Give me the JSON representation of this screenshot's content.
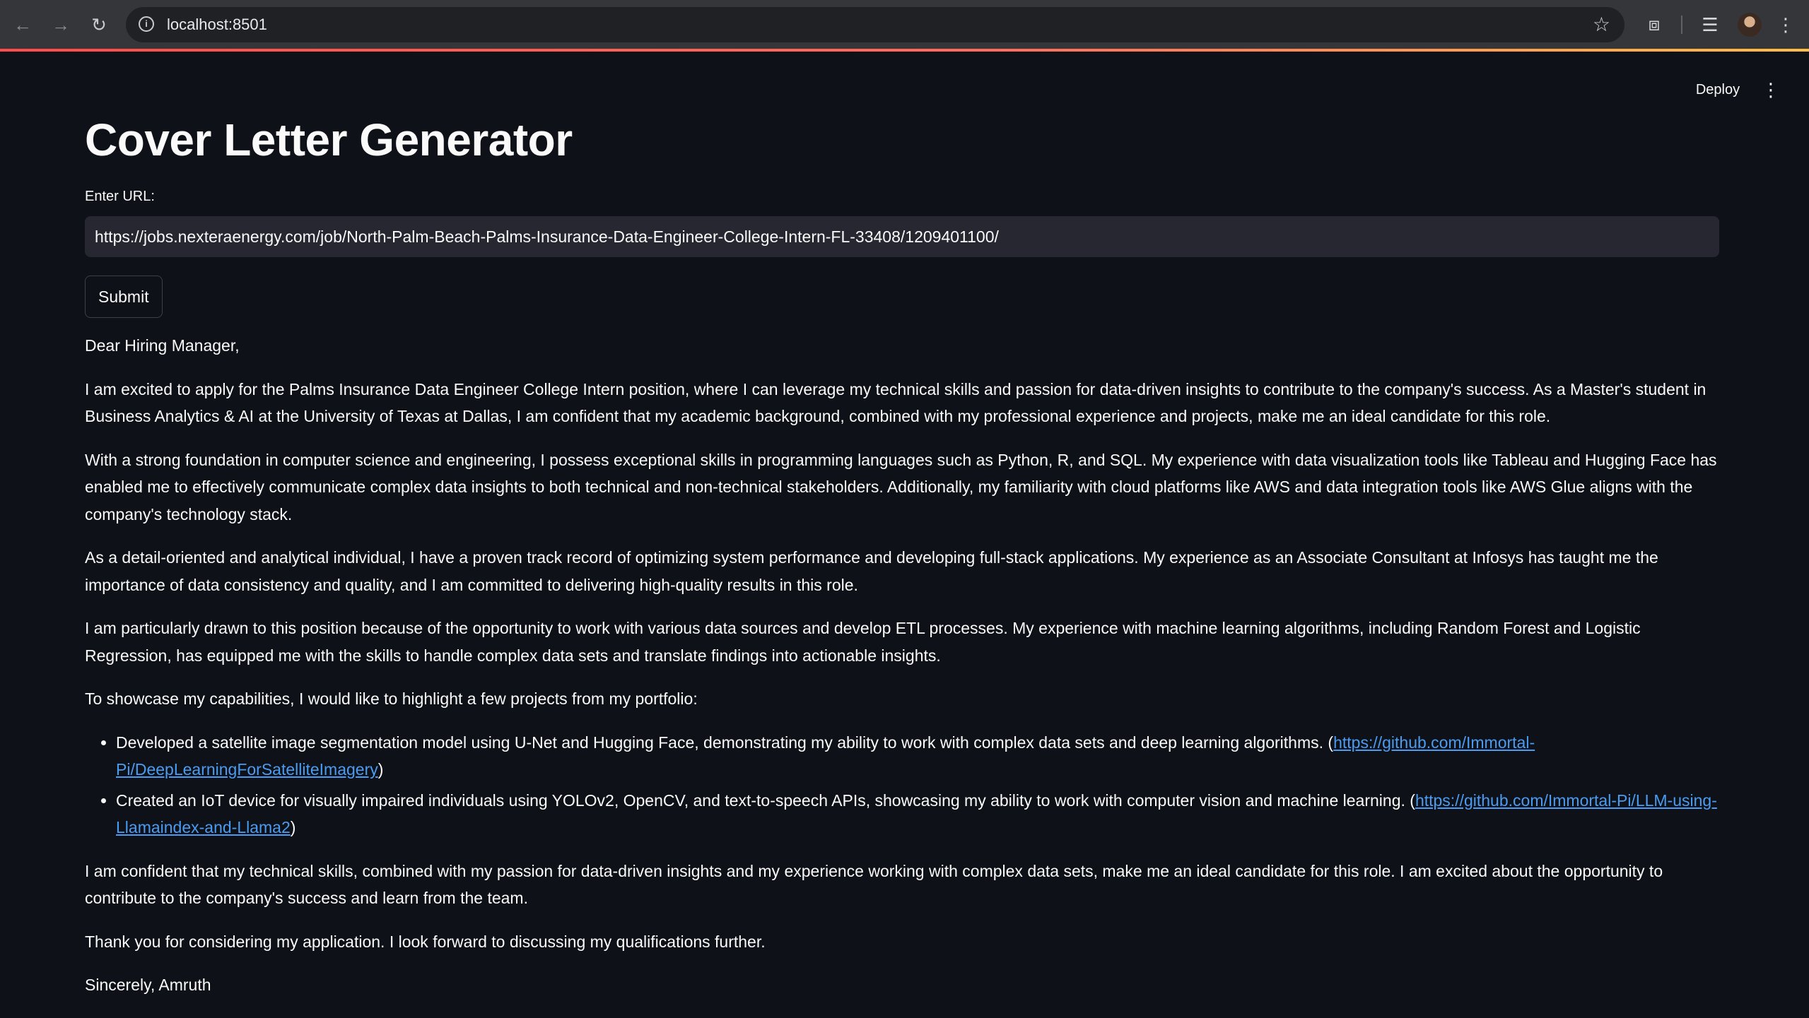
{
  "browser": {
    "url": "localhost:8501",
    "back_icon": "arrow-left-icon",
    "forward_icon": "arrow-right-icon",
    "reload_icon": "reload-icon",
    "star_icon": "star-icon",
    "extensions_icon": "puzzle-icon",
    "media_icon": "media-control-icon",
    "menu_icon": "vertical-dots-icon"
  },
  "header": {
    "deploy_label": "Deploy",
    "menu_icon": "vertical-dots-icon"
  },
  "main": {
    "title": "Cover Letter Generator",
    "url_label": "Enter URL:",
    "url_value": "https://jobs.nexteraenergy.com/job/North-Palm-Beach-Palms-Insurance-Data-Engineer-College-Intern-FL-33408/1209401100/",
    "submit_label": "Submit"
  },
  "letter": {
    "greeting": "Dear Hiring Manager,",
    "p1": "I am excited to apply for the Palms Insurance Data Engineer College Intern position, where I can leverage my technical skills and passion for data-driven insights to contribute to the company's success. As a Master's student in Business Analytics & AI at the University of Texas at Dallas, I am confident that my academic background, combined with my professional experience and projects, make me an ideal candidate for this role.",
    "p2": "With a strong foundation in computer science and engineering, I possess exceptional skills in programming languages such as Python, R, and SQL. My experience with data visualization tools like Tableau and Hugging Face has enabled me to effectively communicate complex data insights to both technical and non-technical stakeholders. Additionally, my familiarity with cloud platforms like AWS and data integration tools like AWS Glue aligns with the company's technology stack.",
    "p3": "As a detail-oriented and analytical individual, I have a proven track record of optimizing system performance and developing full-stack applications. My experience as an Associate Consultant at Infosys has taught me the importance of data consistency and quality, and I am committed to delivering high-quality results in this role.",
    "p4": "I am particularly drawn to this position because of the opportunity to work with various data sources and develop ETL processes. My experience with machine learning algorithms, including Random Forest and Logistic Regression, has equipped me with the skills to handle complex data sets and translate findings into actionable insights.",
    "p5": "To showcase my capabilities, I would like to highlight a few projects from my portfolio:",
    "projects": [
      {
        "text": "Developed a satellite image segmentation model using U-Net and Hugging Face, demonstrating my ability to work with complex data sets and deep learning algorithms. (",
        "link": "https://github.com/Immortal-Pi/DeepLearningForSatelliteImagery",
        "after": ")"
      },
      {
        "text": "Created an IoT device for visually impaired individuals using YOLOv2, OpenCV, and text-to-speech APIs, showcasing my ability to work with computer vision and machine learning. (",
        "link": "https://github.com/Immortal-Pi/LLM-using-Llamaindex-and-Llama2",
        "after": ")"
      }
    ],
    "p6": "I am confident that my technical skills, combined with my passion for data-driven insights and my experience working with complex data sets, make me an ideal candidate for this role. I am excited about the opportunity to contribute to the company's success and learn from the team.",
    "p7": "Thank you for considering my application. I look forward to discussing my qualifications further.",
    "signoff": "Sincerely, Amruth"
  }
}
